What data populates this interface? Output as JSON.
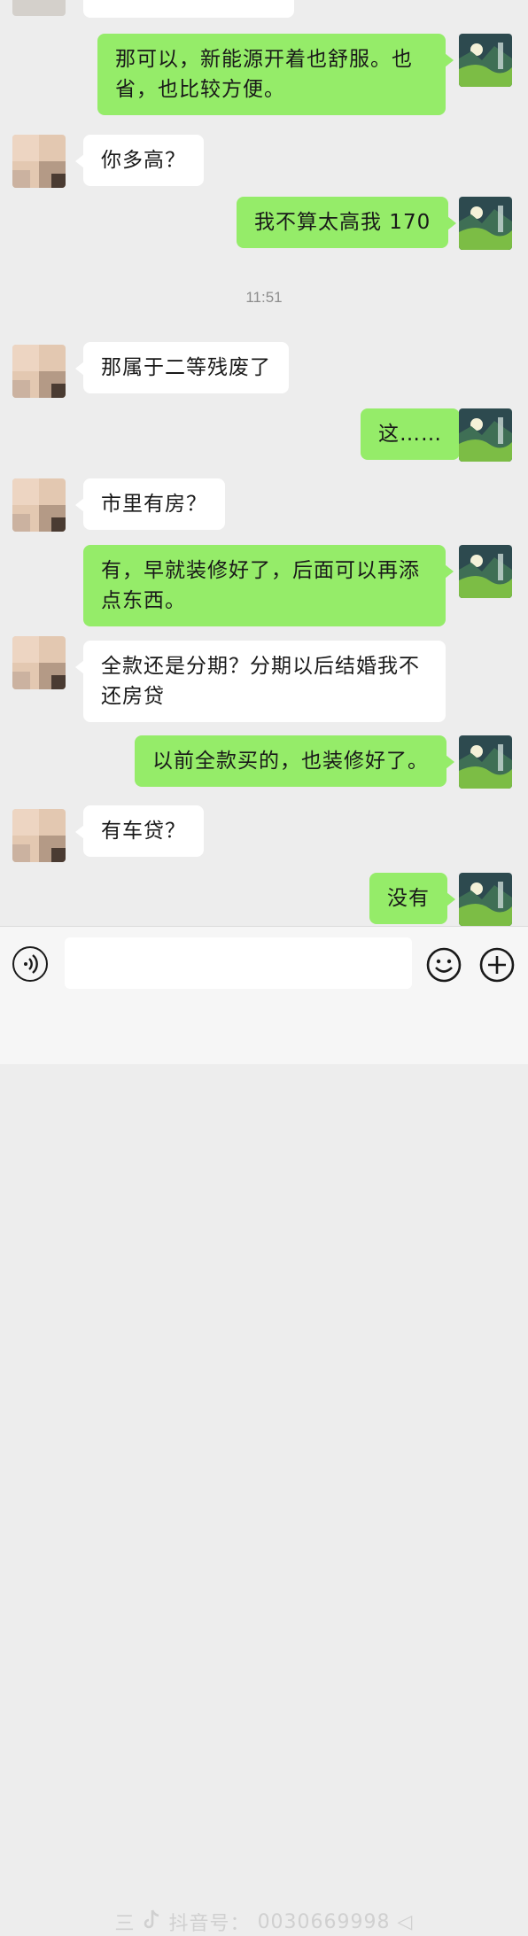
{
  "colors": {
    "background": "#ededed",
    "outgoing_bubble": "#95ec69",
    "incoming_bubble": "#ffffff",
    "timestamp": "#8d8d8d"
  },
  "messages": [
    {
      "side": "right",
      "text": "那可以，新能源开着也舒服。也省，也比较方便。"
    },
    {
      "side": "left",
      "text": "你多高？"
    },
    {
      "side": "right",
      "text": "我不算太高我 170"
    },
    {
      "side": "left",
      "text": "那属于二等残废了"
    },
    {
      "side": "right",
      "text": "这……"
    },
    {
      "side": "left",
      "text": "市里有房？"
    },
    {
      "side": "right",
      "text": "有，早就装修好了，后面可以再添点东西。"
    },
    {
      "side": "left",
      "text": "全款还是分期？分期以后结婚我不还房贷"
    },
    {
      "side": "right",
      "text": "以前全款买的，也装修好了。"
    },
    {
      "side": "left",
      "text": "有车贷？"
    },
    {
      "side": "right",
      "text": "没有"
    }
  ],
  "timestamp": "11:51",
  "input_bar": {
    "voice_icon": "voice-icon",
    "emoji_icon": "emoji-icon",
    "plus_icon": "plus-icon",
    "input_value": ""
  },
  "watermark": {
    "prefix": "三",
    "logo_icon": "douyin-icon",
    "label": "抖音号：",
    "id": "0030669998",
    "suffix": "◁"
  }
}
